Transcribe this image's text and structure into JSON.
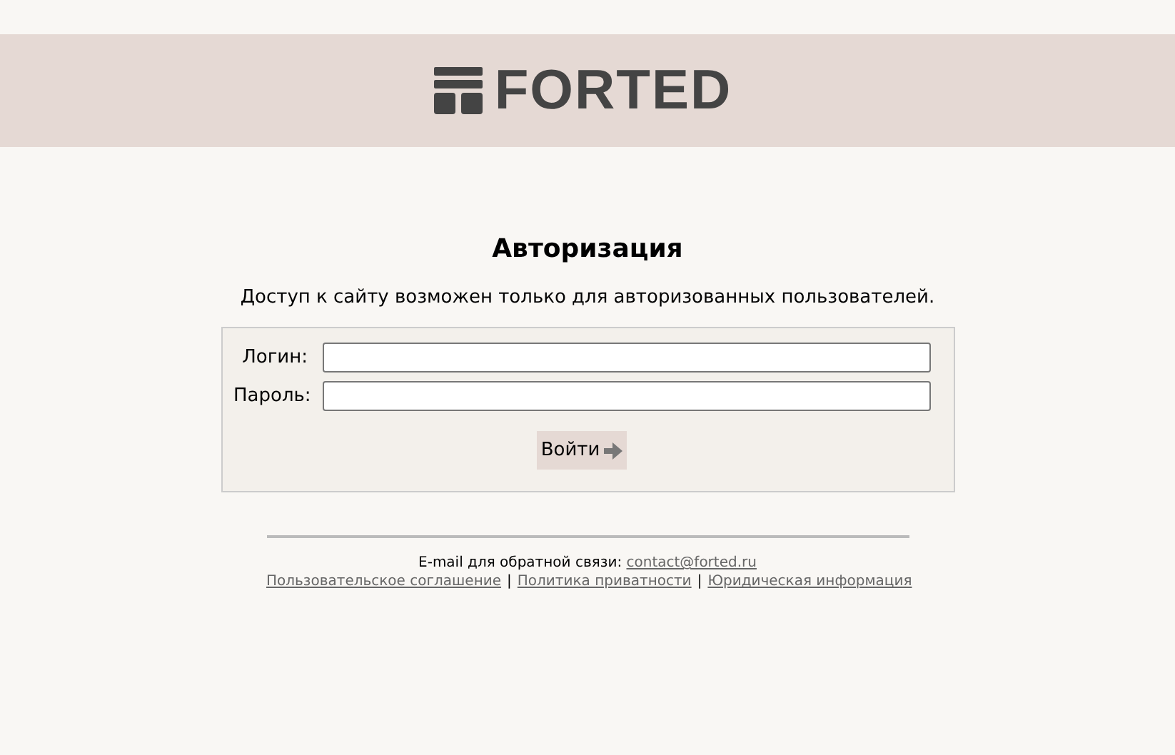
{
  "header": {
    "logo_text": "FORTED"
  },
  "title": "Авторизация",
  "subtitle": "Доступ к сайту возможен только для авторизованных пользователей.",
  "form": {
    "fields": [
      {
        "label": "Логин:"
      },
      {
        "label": "Пароль:"
      }
    ],
    "submit": "Войти"
  },
  "footer": {
    "email_label": "E-mail для обратной связи:",
    "email": "contact@forted.ru",
    "items": [
      {
        "kind": "link",
        "text": "Пользовательское соглашение"
      },
      {
        "kind": "separator",
        "text": "|"
      },
      {
        "kind": "link",
        "text": "Политика приватности"
      },
      {
        "kind": "separator",
        "text": "|"
      },
      {
        "kind": "link",
        "text": "Юридическая информация"
      }
    ]
  }
}
